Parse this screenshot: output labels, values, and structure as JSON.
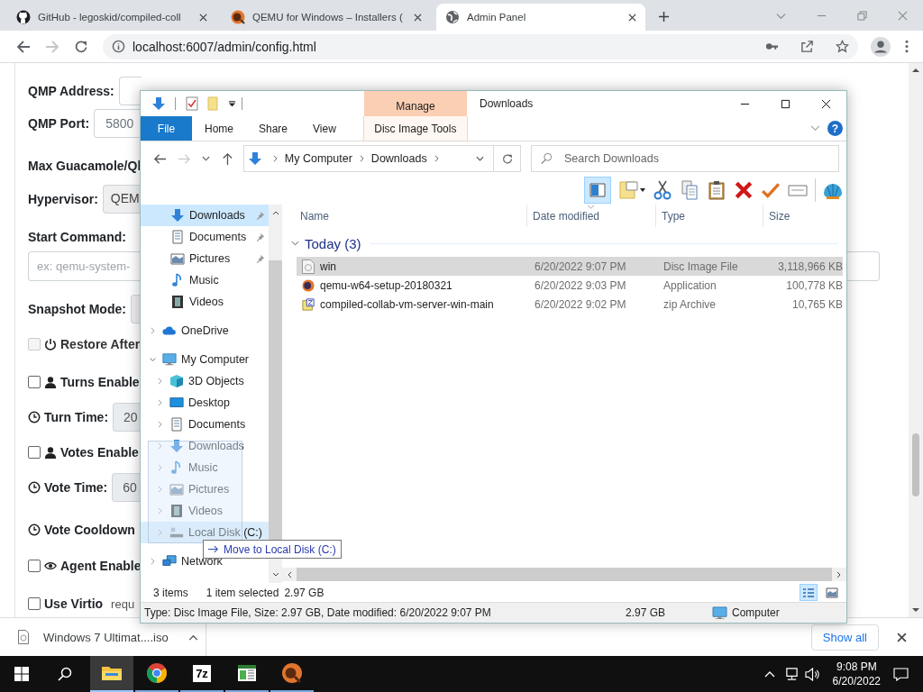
{
  "browser": {
    "tabs": [
      {
        "title": "GitHub - legoskid/compiled-coll",
        "kind": "github",
        "selected": false
      },
      {
        "title": "QEMU for Windows – Installers (",
        "kind": "qemu",
        "selected": false
      },
      {
        "title": "Admin Panel",
        "kind": "globe",
        "selected": true
      }
    ],
    "address": "localhost:6007/admin/config.html"
  },
  "admin_form": {
    "rows": [
      {
        "kind": "input",
        "label": "QMP Address:"
      },
      {
        "kind": "input",
        "label": "QMP Port:",
        "value": "5800"
      },
      {
        "kind": "label",
        "label": "Max Guacamole/Ql"
      },
      {
        "kind": "select",
        "label": "Hypervisor:",
        "value": "QEM"
      },
      {
        "kind": "heading",
        "label": "Start Command:"
      },
      {
        "kind": "wide-input",
        "placeholder": "ex: qemu-system-"
      },
      {
        "kind": "select",
        "label": "Snapshot Mode:"
      },
      {
        "kind": "checkbox",
        "label": "Restore After",
        "checked": false,
        "disabled": true
      },
      {
        "kind": "checkbox",
        "label": "Turns Enable",
        "checked": false,
        "disabled": false
      },
      {
        "kind": "input",
        "label": "Turn Time:",
        "value": "20"
      },
      {
        "kind": "checkbox",
        "label": "Votes Enable",
        "checked": false,
        "disabled": false
      },
      {
        "kind": "input",
        "label": "Vote Time:",
        "value": "60"
      },
      {
        "kind": "label",
        "label": "Vote Cooldown"
      },
      {
        "kind": "checkbox",
        "label": "Agent Enable",
        "checked": false,
        "disabled": false
      },
      {
        "kind": "checkbox",
        "label": "Use Virtio",
        "note": "requ",
        "checked": false,
        "disabled": false
      }
    ]
  },
  "explorer": {
    "title": "Downloads",
    "context_group": "Manage",
    "help": "?",
    "ribbon_tabs": [
      {
        "label": "File",
        "kind": "file",
        "selected": false
      },
      {
        "label": "Home",
        "kind": "normal",
        "selected": false
      },
      {
        "label": "Share",
        "kind": "normal",
        "selected": false
      },
      {
        "label": "View",
        "kind": "normal",
        "selected": false
      },
      {
        "label": "Disc Image Tools",
        "kind": "contextual",
        "selected": false
      }
    ],
    "breadcrumbs": [
      "My Computer",
      "Downloads"
    ],
    "search": {
      "placeholder": "Search Downloads"
    },
    "nav": [
      {
        "label": "Downloads",
        "kind": "downloads",
        "pinned": true,
        "selected": true
      },
      {
        "label": "Documents",
        "kind": "documents",
        "pinned": true,
        "selected": false
      },
      {
        "label": "Pictures",
        "kind": "pictures",
        "pinned": true,
        "selected": false
      },
      {
        "label": "Music",
        "kind": "music",
        "pinned": false,
        "selected": false
      },
      {
        "label": "Videos",
        "kind": "videos",
        "pinned": false,
        "selected": false
      },
      {
        "label": "OneDrive",
        "kind": "cloud",
        "expanded": false,
        "selected": false
      },
      {
        "label": "My Computer",
        "kind": "computer",
        "expanded": true,
        "selected": false,
        "children": [
          {
            "label": "3D Objects",
            "kind": "cube",
            "expanded": false,
            "selected": false
          },
          {
            "label": "Desktop",
            "kind": "desktop",
            "expanded": false,
            "selected": false
          },
          {
            "label": "Documents",
            "kind": "documents",
            "expanded": false,
            "selected": false
          },
          {
            "label": "Downloads",
            "kind": "downloads",
            "expanded": false,
            "selected": false
          },
          {
            "label": "Music",
            "kind": "music",
            "expanded": false,
            "selected": false
          },
          {
            "label": "Pictures",
            "kind": "pictures",
            "expanded": false,
            "selected": false
          },
          {
            "label": "Videos",
            "kind": "videos",
            "expanded": false,
            "selected": false
          },
          {
            "label": "Local Disk (C:)",
            "kind": "disk",
            "expanded": false,
            "selected": false,
            "drop_target": true
          }
        ]
      },
      {
        "label": "Network",
        "kind": "network",
        "expanded": false,
        "selected": false
      }
    ],
    "drag_tooltip": "Move to Local Disk (C:)",
    "columns": [
      {
        "label": "Name",
        "sorted": false
      },
      {
        "label": "Date modified",
        "sorted": true
      },
      {
        "label": "Type",
        "sorted": false
      },
      {
        "label": "Size",
        "sorted": false
      }
    ],
    "groups": [
      {
        "label": "Today (3)",
        "expanded": true,
        "rows": [
          {
            "name": "win",
            "date": "6/20/2022 9:07 PM",
            "type": "Disc Image File",
            "size": "3,118,966 KB",
            "kind": "disc",
            "selected": true
          },
          {
            "name": "qemu-w64-setup-20180321",
            "date": "6/20/2022 9:03 PM",
            "type": "Application",
            "size": "100,778 KB",
            "kind": "app",
            "selected": false
          },
          {
            "name": "compiled-collab-vm-server-win-main",
            "date": "6/20/2022 9:02 PM",
            "type": "zip Archive",
            "size": "10,765 KB",
            "kind": "zip",
            "selected": false
          }
        ]
      }
    ],
    "status": {
      "count": "3 items",
      "selection": "1 item selected",
      "selection_size": "2.97 GB"
    },
    "views": [
      {
        "kind": "details",
        "selected": true
      },
      {
        "kind": "tiles",
        "selected": false
      }
    ],
    "details_bar": {
      "text": "Type: Disc Image File, Size: 2.97 GB, Date modified: 6/20/2022 9:07 PM",
      "size": "2.97 GB",
      "location": "Computer"
    }
  },
  "downloads_bar": {
    "file": "Windows 7 Ultimat....iso",
    "show_all": "Show all"
  },
  "taskbar": {
    "apps": [
      {
        "kind": "explorer",
        "selected": true
      },
      {
        "kind": "chrome",
        "selected": false
      },
      {
        "kind": "sevenzip",
        "label": "7z",
        "selected": false
      },
      {
        "kind": "sheet",
        "selected": false
      },
      {
        "kind": "qemu",
        "selected": false
      }
    ],
    "time": "9:08 PM",
    "date": "6/20/2022"
  }
}
